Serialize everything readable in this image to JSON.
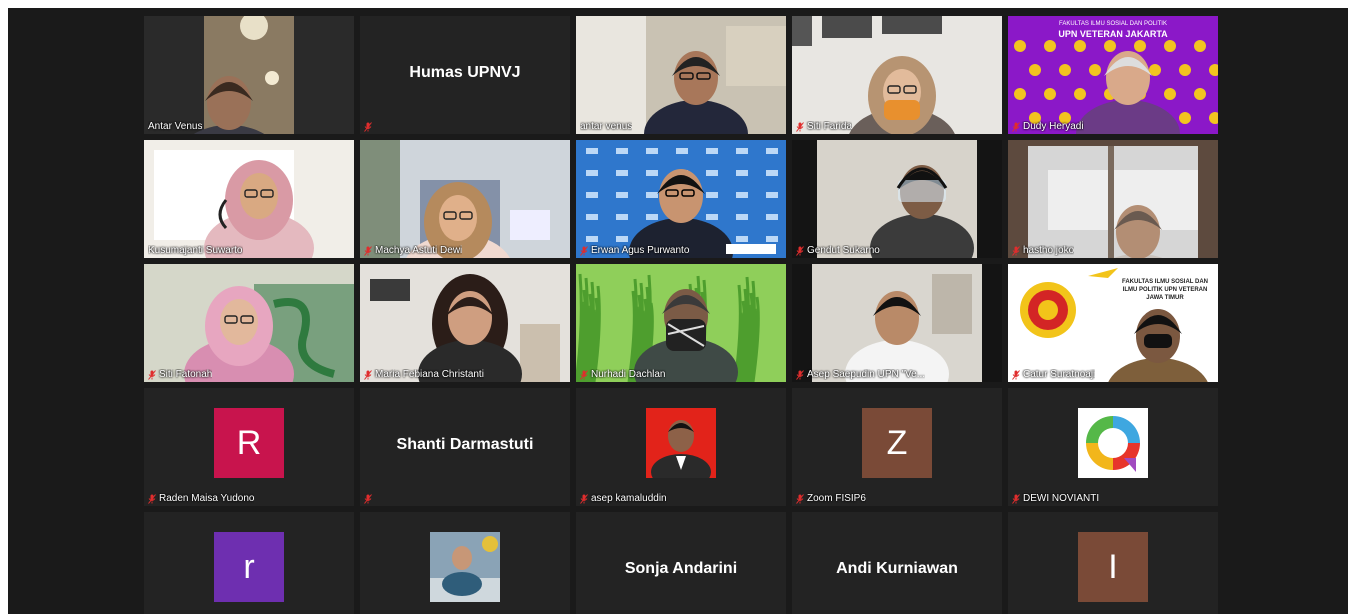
{
  "tiles": [
    {
      "name": "Antar Venus",
      "kind": "video",
      "scene": "dark-room",
      "active": true,
      "mic_muted": false
    },
    {
      "name": "Humas UPNVJ",
      "kind": "name",
      "mic_muted": true
    },
    {
      "name": "antar venus",
      "kind": "video",
      "scene": "office-man",
      "mic_muted": false
    },
    {
      "name": "Siti Farida",
      "kind": "video",
      "scene": "woman-mask",
      "mic_muted": true
    },
    {
      "name": "Dudy Heryadi",
      "kind": "video",
      "scene": "purple-banner",
      "mic_muted": true,
      "banner_line1": "FAKULTAS ILMU SOSIAL DAN POLITIK",
      "banner_line2": "UPN VETERAN JAKARTA"
    },
    {
      "name": "Kusumajanti Suwarto",
      "kind": "video",
      "scene": "woman-hijab-pink",
      "mic_muted": false
    },
    {
      "name": "Machya Astuti Dewi",
      "kind": "video",
      "scene": "woman-hijab-office",
      "mic_muted": true
    },
    {
      "name": "Erwan Agus Purwanto",
      "kind": "video",
      "scene": "blue-backdrop",
      "mic_muted": true
    },
    {
      "name": "Gendut Sukarno",
      "kind": "video",
      "scene": "man-headset",
      "mic_muted": true
    },
    {
      "name": "hastho joko",
      "kind": "video",
      "scene": "window",
      "mic_muted": true
    },
    {
      "name": "Siti Fatonah",
      "kind": "video",
      "scene": "woman-hijab-green",
      "mic_muted": true
    },
    {
      "name": "Maria Febiana Christanti",
      "kind": "video",
      "scene": "young-woman",
      "mic_muted": true
    },
    {
      "name": "Nurhadi Dachlan",
      "kind": "video",
      "scene": "green-grass",
      "mic_muted": true
    },
    {
      "name": "Asep Saepudin UPN \"Ve...",
      "kind": "video",
      "scene": "man-white-shirt",
      "mic_muted": true
    },
    {
      "name": "Catur Suratnoaji",
      "kind": "video",
      "scene": "logo-banner",
      "mic_muted": true,
      "banner_text": "FAKULTAS ILMU SOSIAL DAN ILMU POLITIK UPN VETERAN JAWA TIMUR"
    },
    {
      "name": "Raden Maisa Yudono",
      "kind": "avatar",
      "letter": "R",
      "color": "#c8144d",
      "mic_muted": true
    },
    {
      "name": "Shanti Darmastuti",
      "kind": "name",
      "mic_muted": true
    },
    {
      "name": "asep kamaluddin",
      "kind": "photo",
      "mic_muted": true
    },
    {
      "name": "Zoom FISIP6",
      "kind": "avatar",
      "letter": "Z",
      "color": "#7a4a37",
      "mic_muted": true
    },
    {
      "name": "DEWI NOVIANTI",
      "kind": "logo",
      "mic_muted": true
    },
    {
      "name": "",
      "kind": "avatar",
      "letter": "r",
      "color": "#6e2fb0",
      "mic_muted": false
    },
    {
      "name": "",
      "kind": "photo2",
      "mic_muted": false
    },
    {
      "name": "Sonja Andarini",
      "kind": "name",
      "mic_muted": false
    },
    {
      "name": "Andi Kurniawan",
      "kind": "name",
      "mic_muted": false
    },
    {
      "name": "",
      "kind": "avatar",
      "letter": "I",
      "color": "#7a4a37",
      "mic_muted": false
    }
  ],
  "colors": {
    "stage": "#1a1a1a",
    "tile": "#232323",
    "active_border": "#cfe03c",
    "muted_mic": "#e02d2d"
  },
  "icons": {
    "muted": "muted-mic-icon"
  }
}
